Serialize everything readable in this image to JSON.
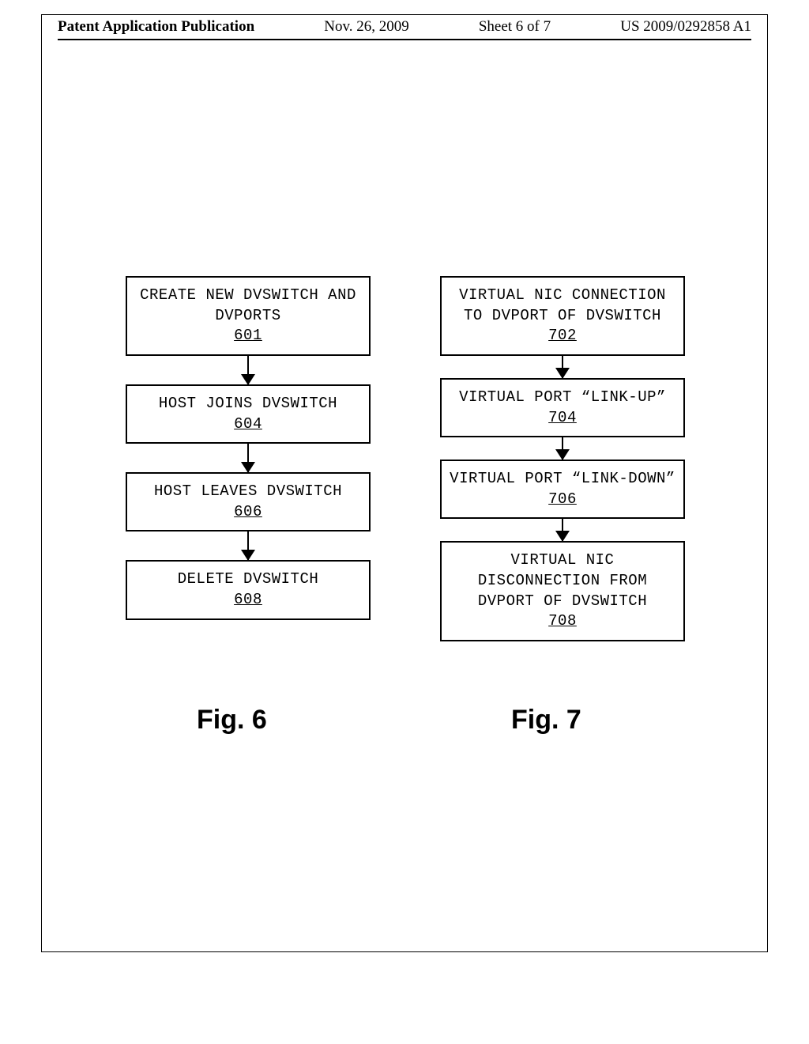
{
  "header": {
    "left": "Patent Application Publication",
    "date": "Nov. 26, 2009",
    "sheet": "Sheet 6 of 7",
    "pubno": "US 2009/0292858 A1"
  },
  "fig6": {
    "boxes": [
      {
        "text": "CREATE NEW DVSWITCH AND DVPORTS",
        "ref": "601"
      },
      {
        "text": "HOST JOINS DVSWITCH",
        "ref": "604"
      },
      {
        "text": "HOST LEAVES DVSWITCH",
        "ref": "606"
      },
      {
        "text": "DELETE DVSWITCH",
        "ref": "608"
      }
    ],
    "caption": "Fig. 6"
  },
  "fig7": {
    "boxes": [
      {
        "text": "VIRTUAL NIC CONNECTION TO DVPORT OF DVSWITCH",
        "ref": "702"
      },
      {
        "text": "VIRTUAL PORT “LINK-UP”",
        "ref": "704"
      },
      {
        "text": "VIRTUAL PORT “LINK-DOWN”",
        "ref": "706"
      },
      {
        "text": "VIRTUAL NIC DISCONNECTION FROM DVPORT OF DVSWITCH",
        "ref": "708"
      }
    ],
    "caption": "Fig. 7"
  }
}
